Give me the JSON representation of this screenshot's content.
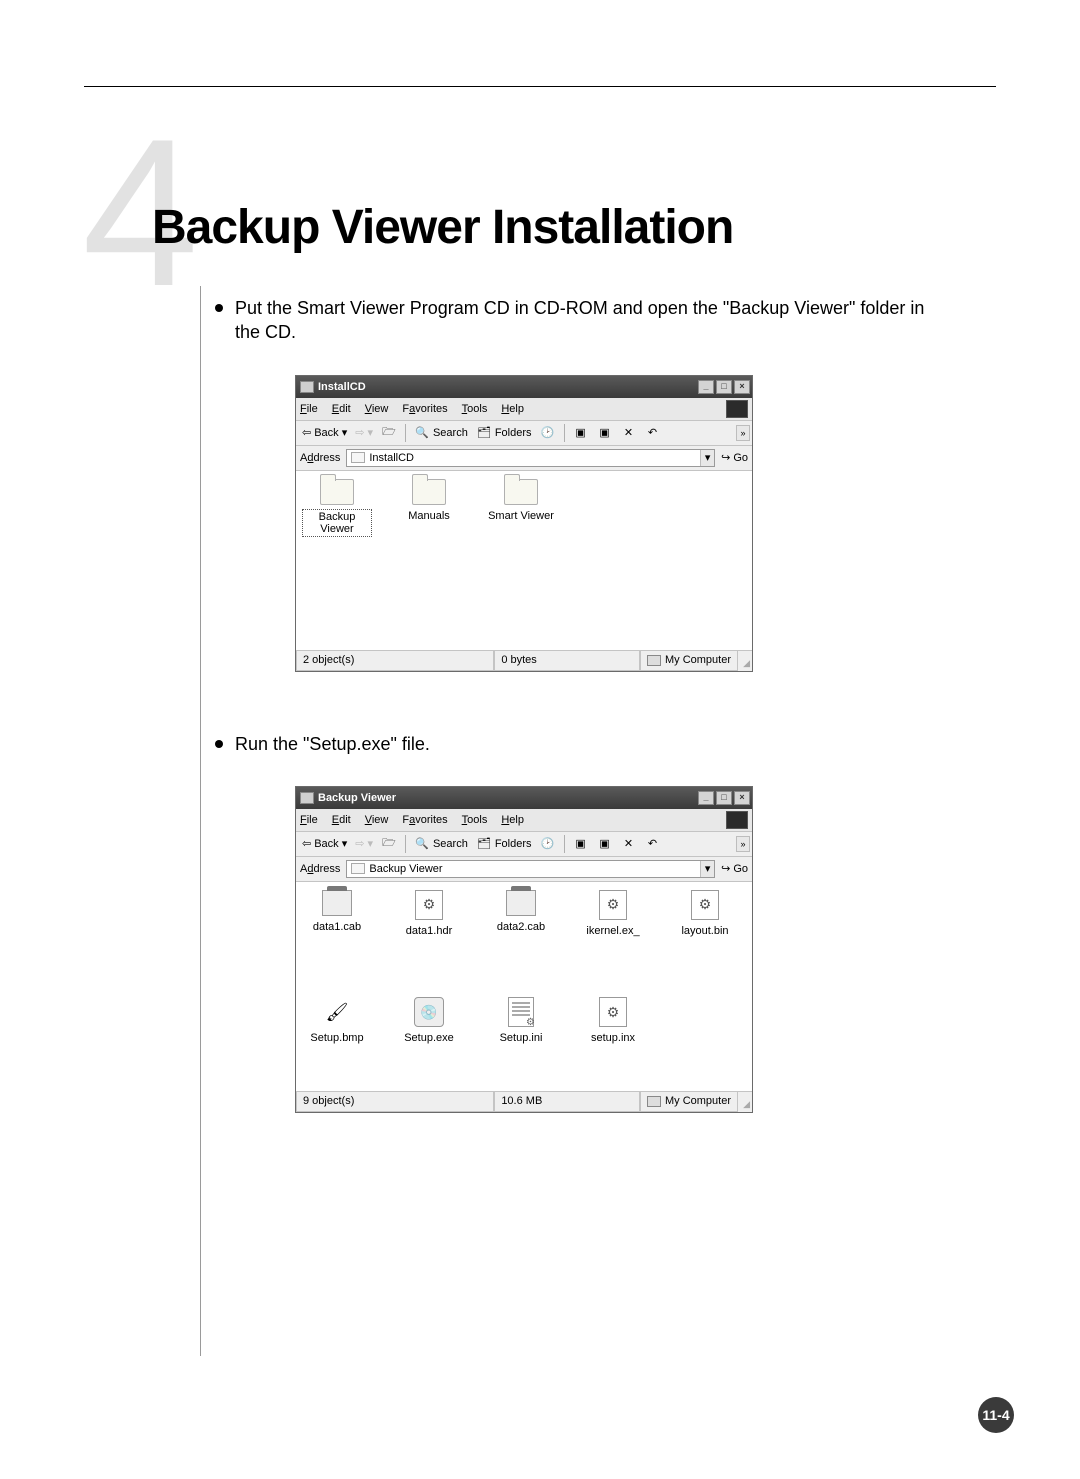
{
  "chapter_number_bg": "4",
  "chapter_title": "Backup Viewer Installation",
  "bullets": [
    "Put the Smart Viewer Program CD in CD-ROM and open the \"Backup Viewer\" folder in the CD.",
    "Run the \"Setup.exe\" file."
  ],
  "page_number": "11-4",
  "explorer_common": {
    "menu": {
      "file": "File",
      "edit": "Edit",
      "view": "View",
      "favorites": "Favorites",
      "tools": "Tools",
      "help": "Help"
    },
    "toolbar": {
      "back": "Back",
      "search": "Search",
      "folders": "Folders",
      "chevron": "»"
    },
    "address_label": "Address",
    "go_label": "Go",
    "status_location": "My Computer",
    "win_min": "_",
    "win_max": "□",
    "win_close": "×",
    "dropdown_glyph": "▾",
    "go_arrow": "↪"
  },
  "window1": {
    "title": "InstallCD",
    "address_value": "InstallCD",
    "files": [
      {
        "name": "Backup Viewer",
        "type": "folder",
        "selected": true
      },
      {
        "name": "Manuals",
        "type": "folder"
      },
      {
        "name": "Smart Viewer",
        "type": "folder"
      }
    ],
    "status_objects": "2 object(s)",
    "status_size": "0 bytes"
  },
  "window2": {
    "title": "Backup Viewer",
    "address_value": "Backup Viewer",
    "files": [
      {
        "name": "data1.cab",
        "type": "cab"
      },
      {
        "name": "data1.hdr",
        "type": "gear"
      },
      {
        "name": "data2.cab",
        "type": "cab"
      },
      {
        "name": "ikernel.ex_",
        "type": "gear"
      },
      {
        "name": "layout.bin",
        "type": "gear"
      },
      {
        "name": "Setup.bmp",
        "type": "bmp"
      },
      {
        "name": "Setup.exe",
        "type": "exe",
        "highlight": true
      },
      {
        "name": "Setup.ini",
        "type": "ini"
      },
      {
        "name": "setup.inx",
        "type": "gear"
      }
    ],
    "status_objects": "9 object(s)",
    "status_size": "10.6 MB"
  }
}
